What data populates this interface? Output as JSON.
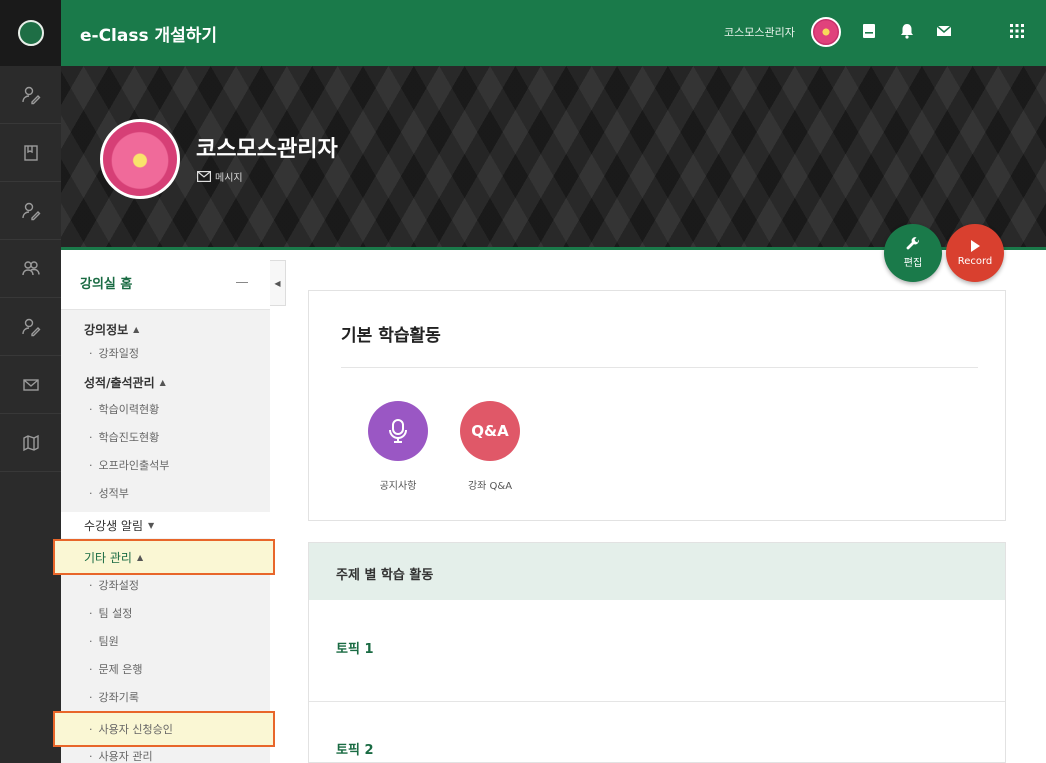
{
  "app": {
    "title": "e-Class 개설하기",
    "user_name": "코스모스관리자"
  },
  "rail": {
    "icons": [
      "user-edit-icon",
      "book-icon",
      "user-edit-icon",
      "users-icon",
      "user-edit-icon",
      "mail-icon",
      "map-icon"
    ]
  },
  "topbar": {
    "icons": [
      "board-icon",
      "bell-icon",
      "mail-icon",
      "apps-grid-icon"
    ]
  },
  "profile": {
    "name": "코스모스관리자",
    "message_label": "메시지"
  },
  "actions": {
    "edit_label": "편집",
    "record_label": "Record"
  },
  "sidebar": {
    "home": "강의실 홈",
    "items": [
      {
        "label": "강의정보",
        "kind": "group"
      },
      {
        "label": "강좌일정",
        "kind": "sub"
      },
      {
        "label": "성적/출석관리",
        "kind": "group"
      },
      {
        "label": "학습이력현황",
        "kind": "sub"
      },
      {
        "label": "학습진도현황",
        "kind": "sub"
      },
      {
        "label": "오프라인출석부",
        "kind": "sub"
      },
      {
        "label": "성적부",
        "kind": "sub"
      },
      {
        "label": "수강생 알림",
        "kind": "plain"
      },
      {
        "label": "기타 관리",
        "kind": "group",
        "highlighted": true
      },
      {
        "label": "강좌설정",
        "kind": "sub"
      },
      {
        "label": "팀 설정",
        "kind": "sub"
      },
      {
        "label": "팀원",
        "kind": "sub"
      },
      {
        "label": "문제 은행",
        "kind": "sub"
      },
      {
        "label": "강좌기록",
        "kind": "sub"
      },
      {
        "label": "사용자 신청승인",
        "kind": "sub",
        "highlighted": true
      },
      {
        "label": "사용자 관리",
        "kind": "sub"
      }
    ]
  },
  "main": {
    "basic_title": "기본 학습활동",
    "activities": [
      {
        "label": "공지사항",
        "icon": "microphone-icon",
        "color": "#9a57c4"
      },
      {
        "label": "강좌 Q&A",
        "icon_text": "Q&A",
        "color": "#e05868"
      }
    ],
    "topic_section_title": "주제 별 학습 활동",
    "topics": [
      "토픽 1",
      "토픽 2"
    ]
  },
  "colors": {
    "brand_green": "#1a7a4a",
    "record_red": "#d9402f",
    "highlight_outline": "#e8662a"
  }
}
